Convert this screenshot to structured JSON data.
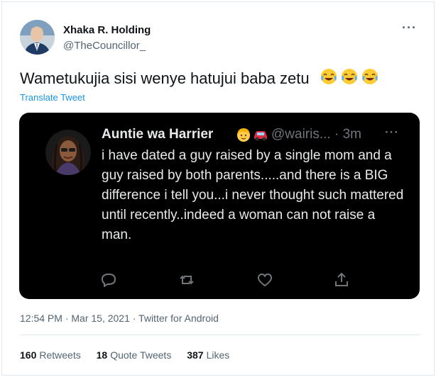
{
  "author": {
    "name": "Xhaka R. Holding",
    "handle": "@TheCouncillor_"
  },
  "tweet": {
    "text": "Wametukujia sisi wenye hatujui baba zetu",
    "emojis": [
      "face-with-tears-of-joy",
      "face-with-tears-of-joy",
      "face-with-tears-of-joy"
    ],
    "translate_label": "Translate Tweet"
  },
  "quoted_tweet": {
    "name": "Auntie wa Harrier",
    "name_emojis": [
      "person-blond-hair",
      "red-car"
    ],
    "handle_time": "@wairis... · 3m",
    "text": "i have dated a guy raised by a single mom and a guy raised by both parents.....and there is a BIG difference i tell you...i never thought such mattered until recently..indeed a woman can not raise a man.",
    "actions": [
      "reply-icon",
      "retweet-icon",
      "like-icon",
      "share-icon"
    ]
  },
  "meta": {
    "timestamp": "12:54 PM · Mar 15, 2021 · Twitter for Android"
  },
  "stats": {
    "retweets_count": "160",
    "retweets_label": "Retweets",
    "quotes_count": "18",
    "quotes_label": "Quote Tweets",
    "likes_count": "387",
    "likes_label": "Likes"
  },
  "colors": {
    "link": "#1b95e0",
    "secondary_text": "#536471",
    "quote_bg": "#000000"
  }
}
